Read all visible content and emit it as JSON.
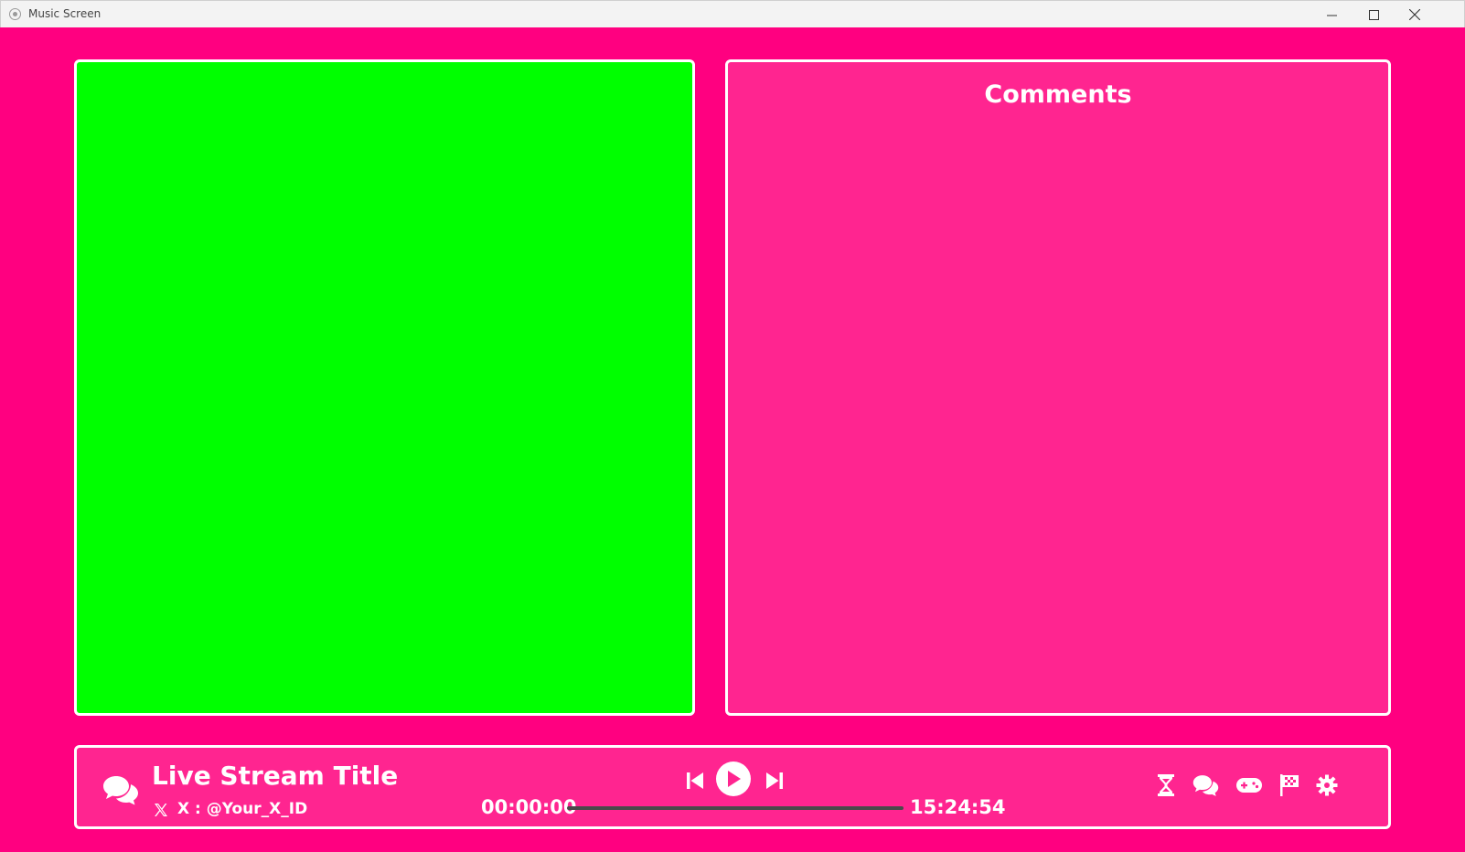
{
  "window": {
    "title": "Music Screen",
    "controls": {
      "minimize": "minimize-icon",
      "maximize": "maximize-icon",
      "close": "close-icon"
    }
  },
  "video_panel": {
    "color": "#00ff00"
  },
  "comments": {
    "title": "Comments"
  },
  "player": {
    "stream_title": "Live Stream Title",
    "x_label": "X : @Your_X_ID",
    "time_current": "00:00:00",
    "time_total": "15:24:54",
    "progress": 0,
    "controls": [
      "previous-icon",
      "play-icon",
      "next-icon"
    ]
  },
  "toolbar": {
    "icons": [
      "hourglass-icon",
      "chat-icon",
      "gamepad-icon",
      "checkered-flag-icon",
      "gear-icon"
    ]
  },
  "colors": {
    "background": "#ff0080",
    "panel": "#ff2590",
    "border": "#ffffff",
    "chroma": "#00ff00"
  }
}
